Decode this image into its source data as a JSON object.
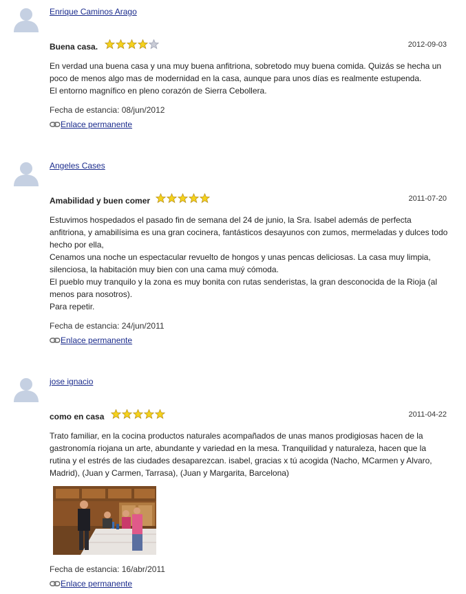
{
  "colors": {
    "link": "#1a2b8c",
    "avatar": "#c5d0e2",
    "star_on": "#f5d21d",
    "star_off": "#c9ccd6"
  },
  "reviews": [
    {
      "author": "Enrique Caminos Arago",
      "title": "Buena casa.",
      "rating": 4,
      "max_rating": 5,
      "date": "2012-09-03",
      "paragraphs": [
        "En verdad una buena casa y una muy buena anfitriona, sobretodo muy buena comida. Quizás se hecha un poco de menos algo mas de modernidad en la casa, aunque para unos días es realmente estupenda.",
        "El entorno magnífico en pleno corazón de Sierra Cebollera."
      ],
      "stay": "Fecha de estancia: 08/jun/2012",
      "permalink": "Enlace permanente"
    },
    {
      "author": "Angeles Cases",
      "title": "Amabilidad y buen comer",
      "rating": 5,
      "max_rating": 5,
      "date": "2011-07-20",
      "paragraphs": [
        "Estuvimos hospedados el pasado fin de semana del 24 de junio, la Sra. Isabel además de perfecta anfitriona, y amabilísima es una gran cocinera, fantásticos desayunos con zumos, mermeladas y dulces todo hecho por ella,",
        "Cenamos una noche un espectacular revuelto de hongos y unas pencas deliciosas. La casa muy limpia, silenciosa, la habitación muy bien con una cama muý cómoda.",
        "El pueblo muy tranquilo y la zona es muy bonita con rutas senderistas, la gran desconocida de la Rioja (al menos para nosotros).",
        "Para repetir."
      ],
      "stay": "Fecha de estancia: 24/jun/2011",
      "permalink": "Enlace permanente"
    },
    {
      "author": "jose ignacio",
      "title": "como en casa",
      "rating": 5,
      "max_rating": 5,
      "date": "2011-04-22",
      "paragraphs": [
        "Trato familiar, en la cocina productos naturales acompañados de unas manos prodigiosas hacen de la gastronomía riojana un arte, abundante y variedad en la mesa. Tranquilidad y naturaleza, hacen que la rutina y el estrés de las ciudades desaparezcan. isabel, gracias x tú acogida (Nacho, MCarmen y Alvaro, Madrid), (Juan y Carmen, Tarrasa), (Juan y Margarita, Barcelona)"
      ],
      "stay": "Fecha de estancia: 16/abr/2011",
      "permalink": "Enlace permanente"
    }
  ]
}
